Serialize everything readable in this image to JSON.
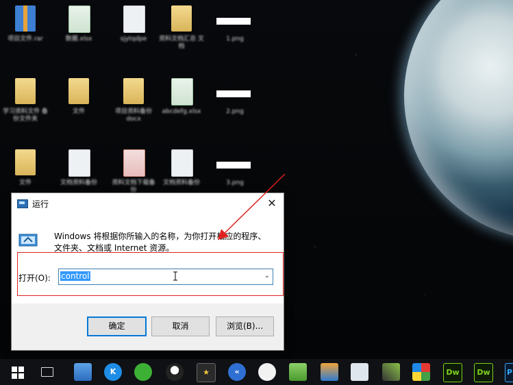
{
  "desktop": {
    "icons": [
      {
        "caption": "项目文件.rar"
      },
      {
        "caption": "数据.xlsx"
      },
      {
        "caption": "sjytqdpe"
      },
      {
        "caption": "资料文档汇总 文档"
      },
      {
        "caption": "1.png"
      },
      {
        "caption": "学习资料文件 备份文件夹"
      },
      {
        "caption": "文件"
      },
      {
        "caption": "项目资料备份 docx"
      },
      {
        "caption": "abcdefg.xlsx"
      },
      {
        "caption": "2.png"
      },
      {
        "caption": "文件"
      },
      {
        "caption": "文档资料备份"
      },
      {
        "caption": "资料文档下载备份"
      },
      {
        "caption": "文档资料备份"
      },
      {
        "caption": "3.png"
      }
    ]
  },
  "dialog": {
    "title": "运行",
    "close": "✕",
    "description": "Windows 将根据你所输入的名称，为你打开相应的程序、文件夹、文档或 Internet 资源。",
    "open_label": "打开(O):",
    "input_value": "control",
    "ok": "确定",
    "cancel": "取消",
    "browse": "浏览(B)..."
  },
  "taskbar": {
    "apps": [
      {
        "name": "task-view-icon",
        "label": ""
      },
      {
        "name": "computer-app-icon",
        "label": ""
      },
      {
        "name": "kugou-icon",
        "label": "K"
      },
      {
        "name": "wechat-icon",
        "label": ""
      },
      {
        "name": "qq-icon",
        "label": ""
      },
      {
        "name": "star-app-icon",
        "label": "★"
      },
      {
        "name": "browser-app-icon",
        "label": "«"
      },
      {
        "name": "chat-bubble-icon",
        "label": ""
      },
      {
        "name": "notes-app-icon",
        "label": ""
      },
      {
        "name": "cube-app-icon",
        "label": ""
      },
      {
        "name": "monitor-app-icon",
        "label": ""
      },
      {
        "name": "tool-app-icon",
        "label": ""
      },
      {
        "name": "tiles-app-icon",
        "label": ""
      },
      {
        "name": "dreamweaver-icon",
        "label": "Dw"
      },
      {
        "name": "dreamweaver-2-icon",
        "label": "Dw"
      },
      {
        "name": "photoshop-icon",
        "label": "P"
      }
    ]
  },
  "colors": {
    "accent": "#0078d7",
    "highlight_box": "#e02020",
    "selection": "#3399ff"
  }
}
